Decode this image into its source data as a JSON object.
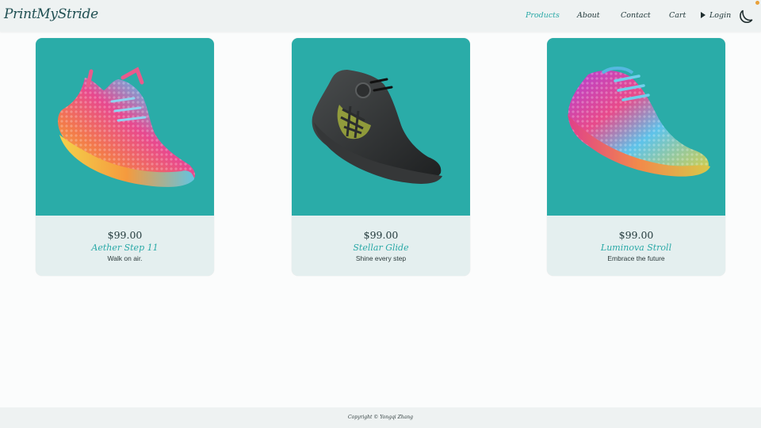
{
  "brand": "PrintMyStride",
  "nav": {
    "items": [
      "Products",
      "About",
      "Contact",
      "Cart"
    ],
    "login": "Login",
    "active": "Products"
  },
  "icons": {
    "login": "play-arrow-icon",
    "theme": "crescent-moon-icon"
  },
  "colors": {
    "accent": "#2aa9a7",
    "card_image_bg": "#2aaca8",
    "card_body_bg": "#e4efef"
  },
  "products": [
    {
      "price": "$99.00",
      "name": "Aether Step 11",
      "tagline": "Walk on air."
    },
    {
      "price": "$99.00",
      "name": "Stellar Glide",
      "tagline": "Shine every step"
    },
    {
      "price": "$99.00",
      "name": "Luminova Stroll",
      "tagline": "Embrace the future"
    }
  ],
  "footer": {
    "copyright": "Copyright © Yongqi Zhang"
  }
}
